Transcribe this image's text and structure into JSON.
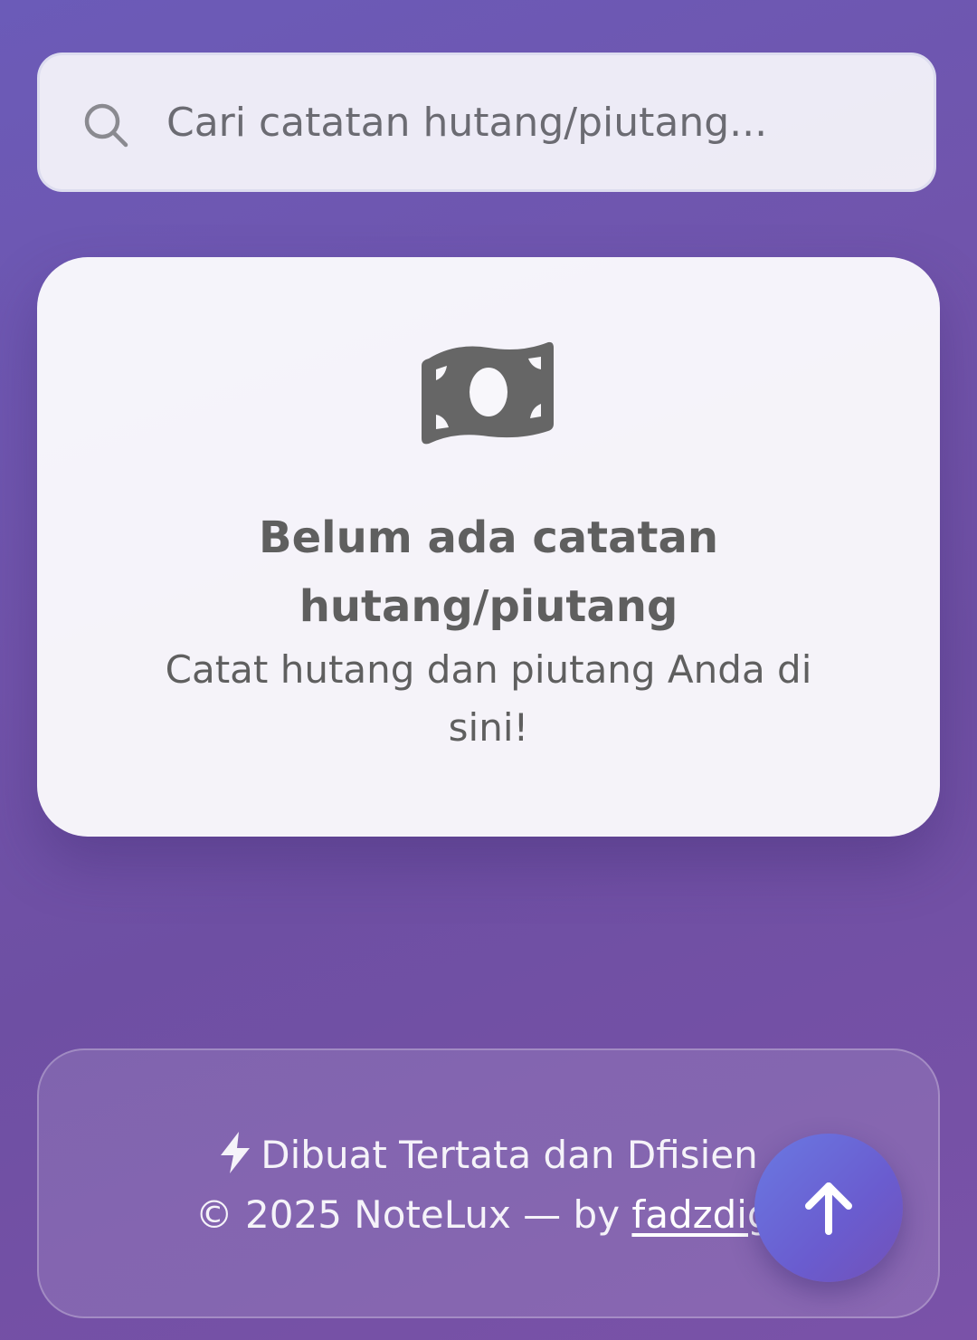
{
  "search": {
    "placeholder": "Cari catatan hutang/piutang..."
  },
  "empty_state": {
    "icon": "money-bill-icon",
    "title": "Belum ada catatan hutang/piutang",
    "subtitle": "Catat hutang dan piutang Anda di sini!"
  },
  "footer": {
    "bolt_icon": "bolt-icon",
    "tagline": "Dibuat Tertata dan Dfisien",
    "copyright_prefix": "© 2025 NoteLux — by",
    "author": "fadzdigi"
  },
  "scroll_top": {
    "icon": "arrow-up-icon"
  },
  "colors": {
    "background": "#7153aa",
    "card": "#f8f7fb",
    "text_muted": "#5f5f5f",
    "fab_gradient_start": "#6a79e2",
    "fab_gradient_end": "#7251b8"
  }
}
